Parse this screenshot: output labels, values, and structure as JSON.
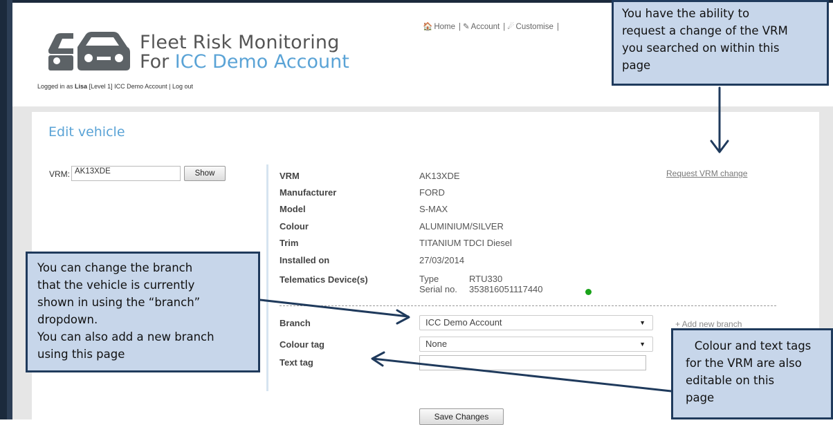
{
  "header": {
    "app_title": "Fleet Risk Monitoring",
    "app_sub_prefix": "For ",
    "app_sub_account": "ICC Demo Account",
    "login_prefix": "Logged in as ",
    "login_user": "Lisa",
    "login_suffix": " [Level 1]  ICC Demo Account | Log out",
    "nav": {
      "home": "Home",
      "account": "Account",
      "customise": "Customise",
      "sep": "|"
    }
  },
  "page": {
    "title": "Edit vehicle",
    "vrm_label": "VRM:",
    "vrm_value": "AK13XDE",
    "show_label": "Show",
    "request_link": "Request VRM change",
    "details": [
      {
        "label": "VRM",
        "value": "AK13XDE"
      },
      {
        "label": "Manufacturer",
        "value": "FORD"
      },
      {
        "label": "Model",
        "value": "S-MAX"
      },
      {
        "label": "Colour",
        "value": "ALUMINIUM/SILVER"
      },
      {
        "label": "Trim",
        "value": "TITANIUM TDCI Diesel"
      },
      {
        "label": "Installed on",
        "value": "27/03/2014"
      }
    ],
    "device": {
      "label": "Telematics Device(s)",
      "type_label": "Type",
      "type_value": "RTU330",
      "serial_label": "Serial no.",
      "serial_value": "353816051117440",
      "status_color": "#1aa31a"
    },
    "branch": {
      "label": "Branch",
      "value": "ICC Demo Account",
      "add_link": "+ Add new branch"
    },
    "colour_tag": {
      "label": "Colour tag",
      "value": "None"
    },
    "text_tag": {
      "label": "Text tag",
      "value": ""
    },
    "save_label": "Save Changes"
  },
  "callouts": {
    "vrm_change": [
      "You have the ability to",
      "request a change of the VRM",
      "you searched on within this",
      "page"
    ],
    "branch": [
      "You can change the branch",
      "that the vehicle is currently",
      "shown in using the “branch”",
      "dropdown.",
      "You can also add a new branch",
      "using this page"
    ],
    "tags": [
      "Colour and text tags",
      "for the VRM are also",
      "editable on this",
      "page"
    ]
  },
  "colors": {
    "accent": "#5aa3d6",
    "callout_bg": "#c7d6ea",
    "callout_border": "#1f3a5c"
  }
}
